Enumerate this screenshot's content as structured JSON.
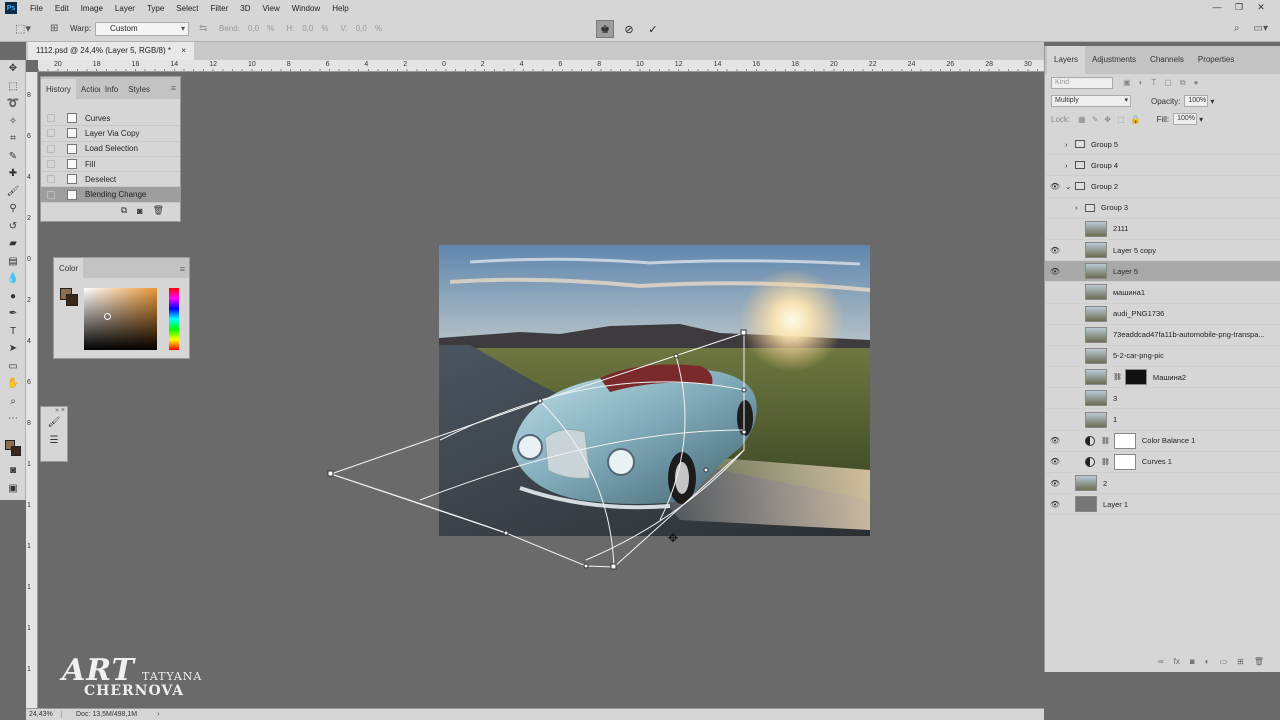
{
  "menu": {
    "items": [
      "File",
      "Edit",
      "Image",
      "Layer",
      "Type",
      "Select",
      "Filter",
      "3D",
      "View",
      "Window",
      "Help"
    ]
  },
  "options_bar": {
    "warp_label": "Warp:",
    "warp_value": "Custom",
    "bend_label": "Bend:",
    "bend_value": "0,0",
    "bend_unit": "%",
    "h_label": "H:",
    "h_value": "0,0",
    "h_unit": "%",
    "v_label": "V:",
    "v_value": "0,0",
    "v_unit": "%"
  },
  "document": {
    "tab_title": "1112.psd @ 24,4% (Layer 5, RGB/8) *"
  },
  "rulers": {
    "h_ticks": [
      "20",
      "18",
      "16",
      "14",
      "12",
      "10",
      "8",
      "6",
      "4",
      "2",
      "0",
      "2",
      "4",
      "6",
      "8",
      "10",
      "12",
      "14",
      "16",
      "18",
      "20",
      "22",
      "24",
      "26",
      "28",
      "30"
    ],
    "v_ticks": [
      "8",
      "6",
      "4",
      "2",
      "0",
      "2",
      "4",
      "6",
      "8",
      "1",
      "1",
      "1",
      "1",
      "1",
      "1"
    ]
  },
  "history": {
    "tabs": [
      "History",
      "Action",
      "Info",
      "Styles"
    ],
    "items": [
      "Curves",
      "Layer Via Copy",
      "Load Selection",
      "Fill",
      "Deselect",
      "Blending Change"
    ],
    "selected_index": 5
  },
  "color_panel": {
    "tab": "Color",
    "foreground": "#8b6f52",
    "background": "#3a2616"
  },
  "layers_panel": {
    "tabs": [
      "Layers",
      "Adjustments",
      "Channels",
      "Properties"
    ],
    "kind_placeholder": "Kind",
    "blend_mode": "Multiply",
    "opacity_label": "Opacity:",
    "opacity_value": "100%",
    "lock_label": "Lock:",
    "fill_label": "Fill:",
    "fill_value": "100%",
    "layers": [
      {
        "name": "Group 5",
        "type": "group",
        "visible": false,
        "indent": 0
      },
      {
        "name": "Group 4",
        "type": "group",
        "visible": false,
        "indent": 0
      },
      {
        "name": "Group 2",
        "type": "group-open",
        "visible": true,
        "indent": 0
      },
      {
        "name": "Group 3",
        "type": "group",
        "visible": false,
        "indent": 1
      },
      {
        "name": "2111",
        "type": "smart",
        "visible": false,
        "indent": 1
      },
      {
        "name": "Layer 5 copy",
        "type": "layer",
        "visible": true,
        "indent": 1
      },
      {
        "name": "Layer 5",
        "type": "layer",
        "visible": true,
        "indent": 1,
        "selected": true
      },
      {
        "name": "машина1",
        "type": "smart",
        "visible": false,
        "indent": 1
      },
      {
        "name": "audi_PNG1736",
        "type": "smart",
        "visible": false,
        "indent": 1
      },
      {
        "name": "73eaddcad47fa11b-automobile-png-transpa...",
        "type": "smart",
        "visible": false,
        "indent": 1
      },
      {
        "name": "5-2-car-png-pic",
        "type": "smart",
        "visible": false,
        "indent": 1
      },
      {
        "name": "Машина2",
        "type": "masked",
        "visible": false,
        "indent": 1
      },
      {
        "name": "3",
        "type": "layer",
        "visible": false,
        "indent": 1
      },
      {
        "name": "1",
        "type": "smart",
        "visible": false,
        "indent": 1
      },
      {
        "name": "Color Balance 1",
        "type": "adjustment",
        "visible": true,
        "indent": 1
      },
      {
        "name": "Curves 1",
        "type": "adjustment",
        "visible": true,
        "indent": 1
      },
      {
        "name": "2",
        "type": "layer",
        "visible": true,
        "indent": 0
      },
      {
        "name": "Layer 1",
        "type": "fill-grey",
        "visible": true,
        "indent": 0
      }
    ]
  },
  "status": {
    "zoom": "24,43%",
    "doc": "Doc: 13,5M/498,1M"
  },
  "watermark": {
    "art": "ART",
    "first": "TATYANA",
    "last": "CHERNOVA"
  }
}
